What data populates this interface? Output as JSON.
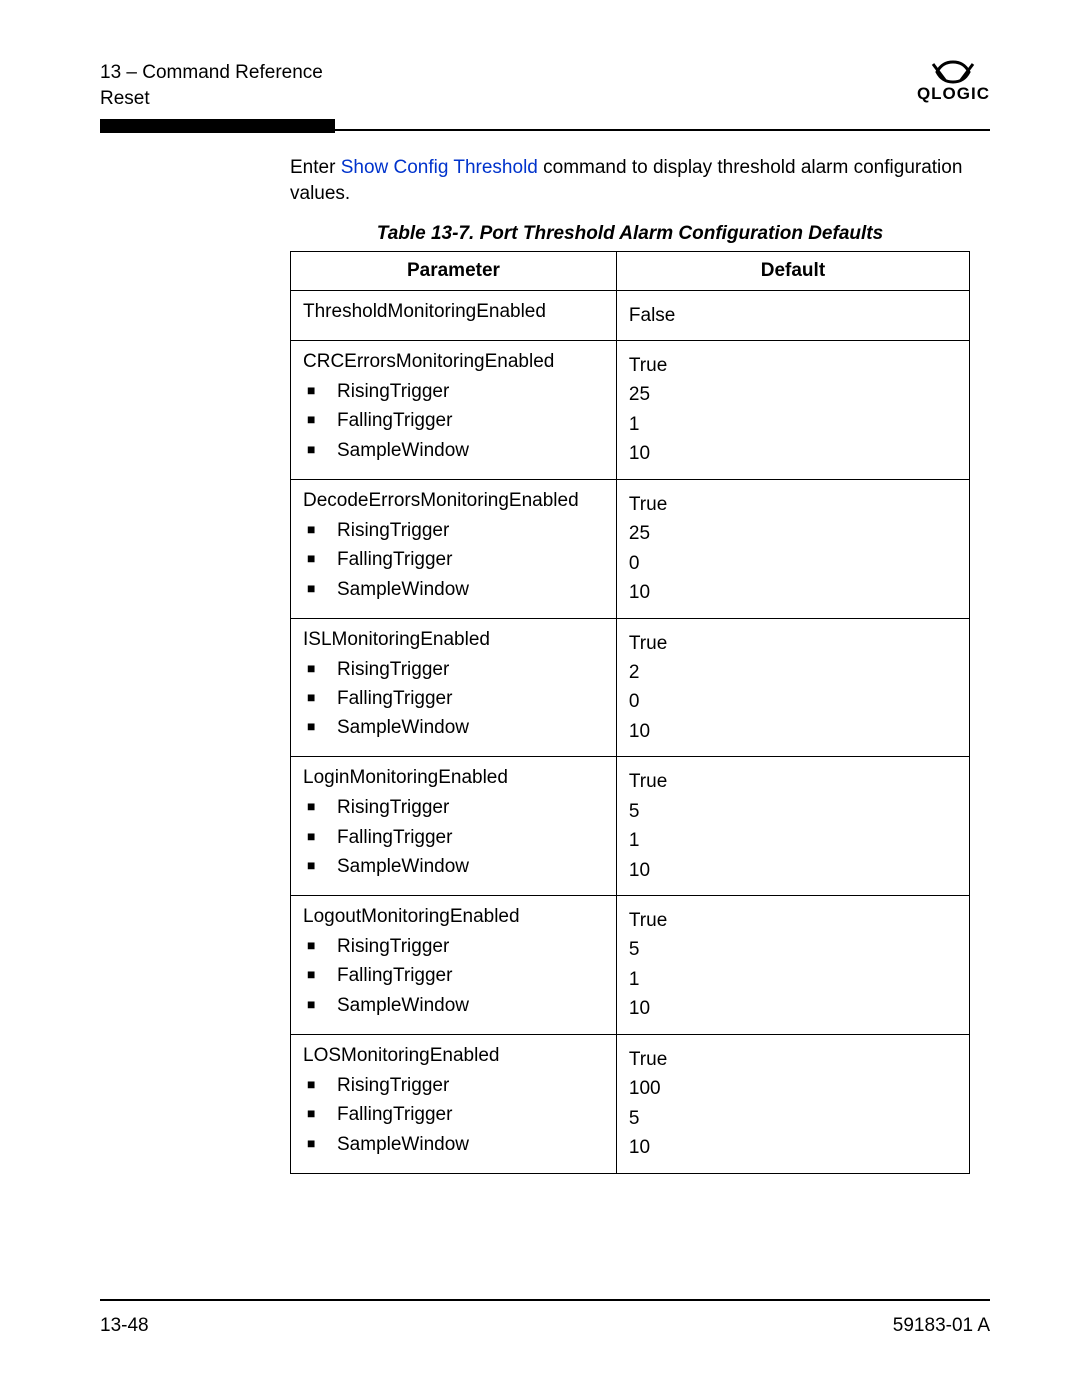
{
  "header": {
    "line1": "13 – Command Reference",
    "line2": "Reset",
    "brand": "QLOGIC"
  },
  "intro": {
    "prefix": "Enter ",
    "link": "Show Config Threshold",
    "suffix": " command to display threshold alarm configuration values."
  },
  "table_title": "Table 13-7. Port Threshold Alarm Configuration Defaults",
  "columns": {
    "parameter": "Parameter",
    "default": "Default"
  },
  "groups": [
    {
      "name": "ThresholdMonitoringEnabled",
      "value": "False",
      "subs": []
    },
    {
      "name": "CRCErrorsMonitoringEnabled",
      "value": "True",
      "subs": [
        {
          "label": "RisingTrigger",
          "value": "25"
        },
        {
          "label": "FallingTrigger",
          "value": "1"
        },
        {
          "label": "SampleWindow",
          "value": "10"
        }
      ]
    },
    {
      "name": "DecodeErrorsMonitoringEnabled",
      "value": "True",
      "subs": [
        {
          "label": "RisingTrigger",
          "value": "25"
        },
        {
          "label": "FallingTrigger",
          "value": "0"
        },
        {
          "label": "SampleWindow",
          "value": "10"
        }
      ]
    },
    {
      "name": "ISLMonitoringEnabled",
      "value": "True",
      "subs": [
        {
          "label": "RisingTrigger",
          "value": "2"
        },
        {
          "label": "FallingTrigger",
          "value": "0"
        },
        {
          "label": "SampleWindow",
          "value": "10"
        }
      ]
    },
    {
      "name": "LoginMonitoringEnabled",
      "value": "True",
      "subs": [
        {
          "label": "RisingTrigger",
          "value": "5"
        },
        {
          "label": "FallingTrigger",
          "value": "1"
        },
        {
          "label": "SampleWindow",
          "value": "10"
        }
      ]
    },
    {
      "name": "LogoutMonitoringEnabled",
      "value": "True",
      "subs": [
        {
          "label": "RisingTrigger",
          "value": "5"
        },
        {
          "label": "FallingTrigger",
          "value": "1"
        },
        {
          "label": "SampleWindow",
          "value": "10"
        }
      ]
    },
    {
      "name": "LOSMonitoringEnabled",
      "value": "True",
      "subs": [
        {
          "label": "RisingTrigger",
          "value": "100"
        },
        {
          "label": "FallingTrigger",
          "value": "5"
        },
        {
          "label": "SampleWindow",
          "value": "10"
        }
      ]
    }
  ],
  "footer": {
    "left": "13-48",
    "right": "59183-01 A"
  }
}
